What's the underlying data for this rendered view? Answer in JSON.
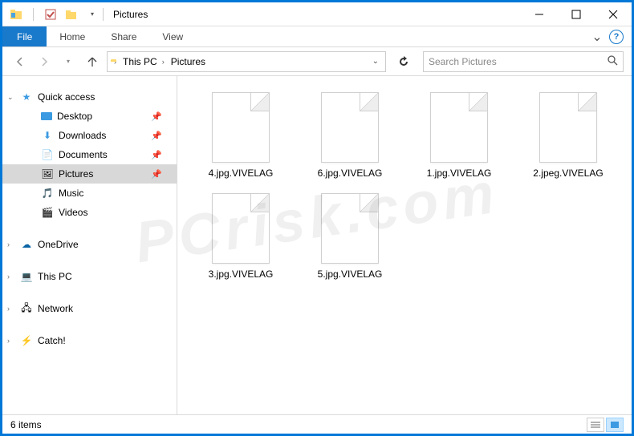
{
  "window": {
    "title": "Pictures"
  },
  "ribbon": {
    "file": "File",
    "tabs": [
      "Home",
      "Share",
      "View"
    ]
  },
  "nav": {
    "crumbs": [
      "This PC",
      "Pictures"
    ],
    "search_placeholder": "Search Pictures"
  },
  "sidebar": {
    "quick_access": "Quick access",
    "items": [
      {
        "label": "Desktop",
        "pinned": true
      },
      {
        "label": "Downloads",
        "pinned": true
      },
      {
        "label": "Documents",
        "pinned": true
      },
      {
        "label": "Pictures",
        "pinned": true,
        "selected": true
      },
      {
        "label": "Music",
        "pinned": false
      },
      {
        "label": "Videos",
        "pinned": false
      }
    ],
    "roots": [
      {
        "label": "OneDrive"
      },
      {
        "label": "This PC"
      },
      {
        "label": "Network"
      },
      {
        "label": "Catch!"
      }
    ]
  },
  "files": [
    {
      "name": "4.jpg.VIVELAG"
    },
    {
      "name": "6.jpg.VIVELAG"
    },
    {
      "name": "1.jpg.VIVELAG"
    },
    {
      "name": "2.jpeg.VIVELAG"
    },
    {
      "name": "3.jpg.VIVELAG"
    },
    {
      "name": "5.jpg.VIVELAG"
    }
  ],
  "status": {
    "count": "6 items"
  }
}
